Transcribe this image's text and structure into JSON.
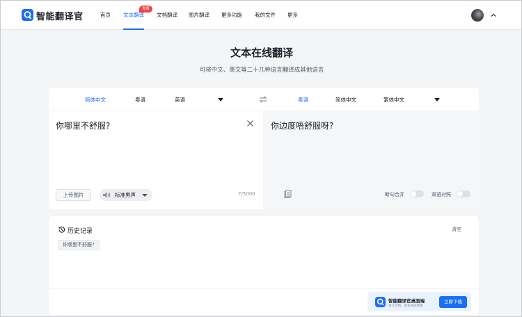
{
  "header": {
    "brand": "智能翻译官",
    "nav": [
      {
        "label": "首页"
      },
      {
        "label": "文本翻译",
        "active": true,
        "badge": "免费"
      },
      {
        "label": "文档翻译"
      },
      {
        "label": "图片翻译"
      },
      {
        "label": "更多功能"
      },
      {
        "label": "我的文件"
      },
      {
        "label": "更多"
      }
    ],
    "accent_color": "#1a6ff5"
  },
  "hero": {
    "title": "文本在线翻译",
    "subtitle": "可将中文、英文等二十几种语言翻译成其他语言"
  },
  "translator": {
    "source_langs": [
      "简体中文",
      "粤语",
      "英语"
    ],
    "source_selected": "简体中文",
    "target_langs": [
      "粤语",
      "简体中文",
      "繁体中文"
    ],
    "target_selected": "粤语",
    "source_text": "你哪里不舒服?",
    "target_text": "你边度唔舒服呀?",
    "upload_label": "上传图片",
    "voice_label": "标准男声",
    "char_count": "7/5000",
    "toggle_merge": "断句合并",
    "toggle_bilingual": "双语对照"
  },
  "history": {
    "title": "历史记录",
    "clear_label": "清空",
    "items": [
      "你哪里不舒服?"
    ]
  },
  "promo": {
    "title": "智能翻译官桌面端",
    "subtitle": "更大文档、更多格式转换",
    "button": "立即下载"
  }
}
